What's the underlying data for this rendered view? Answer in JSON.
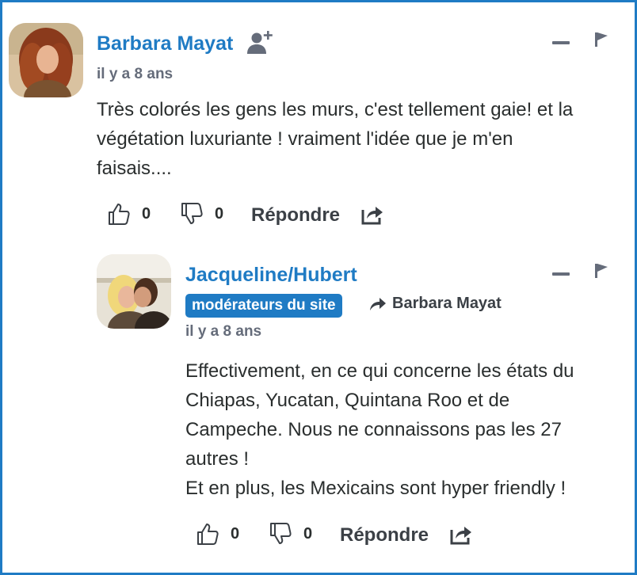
{
  "comments": [
    {
      "author": "Barbara Mayat",
      "time": "il y a 8 ans",
      "body_lines": [
        "Très colorés les gens les murs, c'est tellement gaie! et la",
        "végétation luxuriante ! vraiment l'idée que je m'en",
        "faisais...."
      ],
      "upvotes": "0",
      "downvotes": "0",
      "reply_label": "Répondre"
    },
    {
      "author": "Jacqueline/Hubert",
      "badge": "modérateurs du site",
      "in_reply_to": "Barbara Mayat",
      "time": "il y a 8 ans",
      "body_lines": [
        "Effectivement, en ce qui concerne les états du",
        "Chiapas, Yucatan, Quintana Roo et de",
        "Campeche. Nous ne connaissons pas les 27",
        "autres !",
        "Et en plus, les Mexicains sont hyper friendly !"
      ],
      "upvotes": "0",
      "downvotes": "0",
      "reply_label": "Répondre"
    }
  ],
  "colors": {
    "accent": "#1f7bc4",
    "text": "#2a2e2e",
    "muted": "#656c7a"
  }
}
